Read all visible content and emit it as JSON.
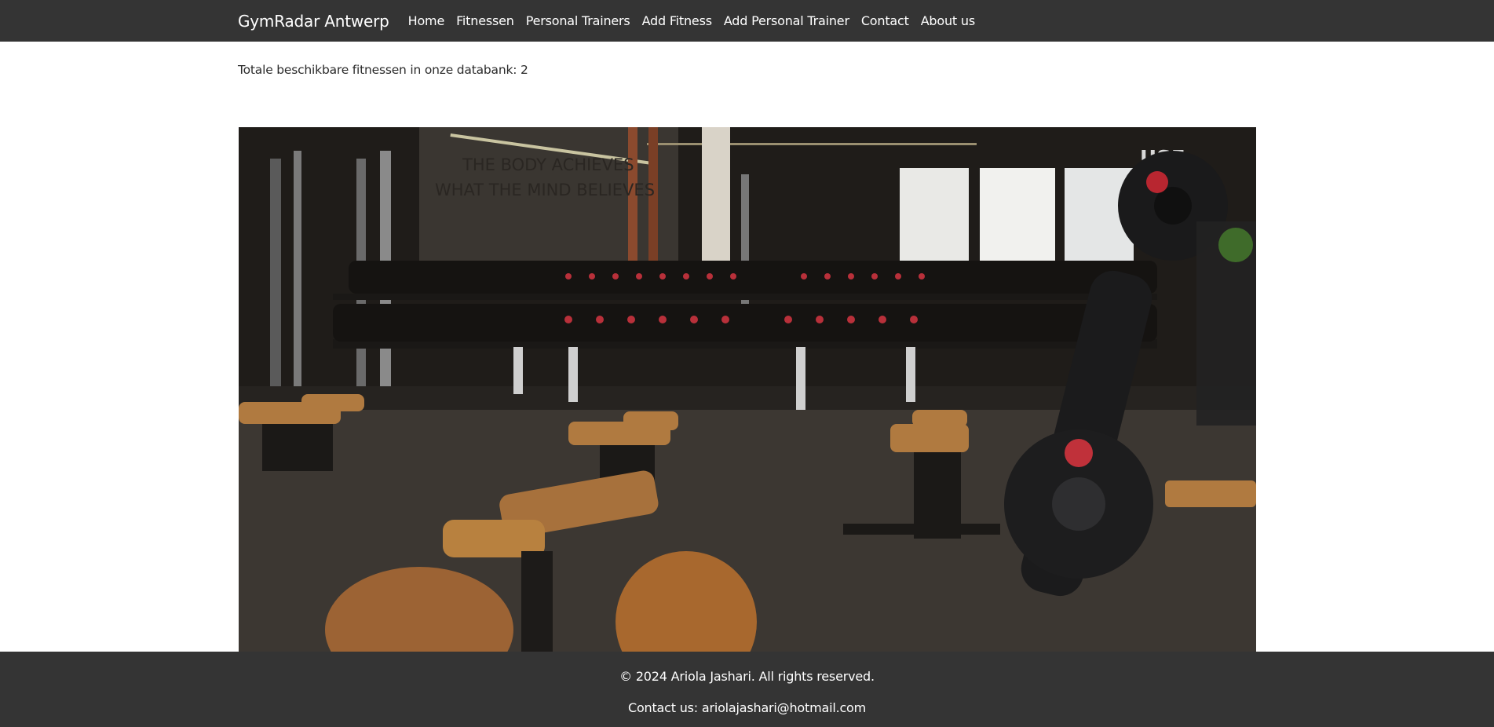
{
  "navbar": {
    "brand": "GymRadar Antwerp",
    "links": [
      "Home",
      "Fitnessen",
      "Personal Trainers",
      "Add Fitness",
      "Add Personal Trainer",
      "Contact",
      "About us"
    ]
  },
  "main": {
    "count_text": "Totale beschikbare fitnessen in onze databank: 2",
    "hero_image": {
      "wall_text_line1": "THE BODY ACHIEVES",
      "wall_text_line2": "WHAT THE MIND BELIEVES",
      "corner_text": "USE"
    }
  },
  "footer": {
    "copyright": "© 2024 Ariola Jashari. All rights reserved.",
    "contact": "Contact us: ariolajashari@hotmail.com"
  },
  "colors": {
    "navbar_bg": "#343434",
    "footer_bg": "#343434",
    "nav_text": "#ffffff"
  }
}
